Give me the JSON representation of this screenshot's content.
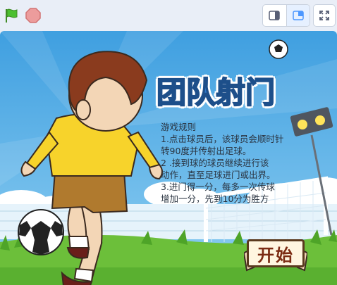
{
  "toolbar": {
    "flag_icon": "green-flag-icon",
    "stop_icon": "stop-icon",
    "small_stage_icon": "small-stage-icon",
    "normal_stage_icon": "normal-stage-icon",
    "fullscreen_icon": "fullscreen-icon"
  },
  "game": {
    "title": "团队射门",
    "rules_heading": "游戏规则",
    "rules_lines": [
      "1.点击球员后，该球员会顺时针",
      "转90度并传射出足球。",
      "2 .接到球的球员继续进行该",
      "动作，直至足球进门或出界。",
      "3.进门得一分，每多一次传球",
      "增加一分，先到10分为胜方"
    ],
    "start_button": "开始"
  },
  "colors": {
    "sky": "#5aaee6",
    "grass": "#6cbf3a",
    "title": "#2f79c8",
    "shirt": "#f7d32b",
    "shorts": "#b07a2e"
  }
}
